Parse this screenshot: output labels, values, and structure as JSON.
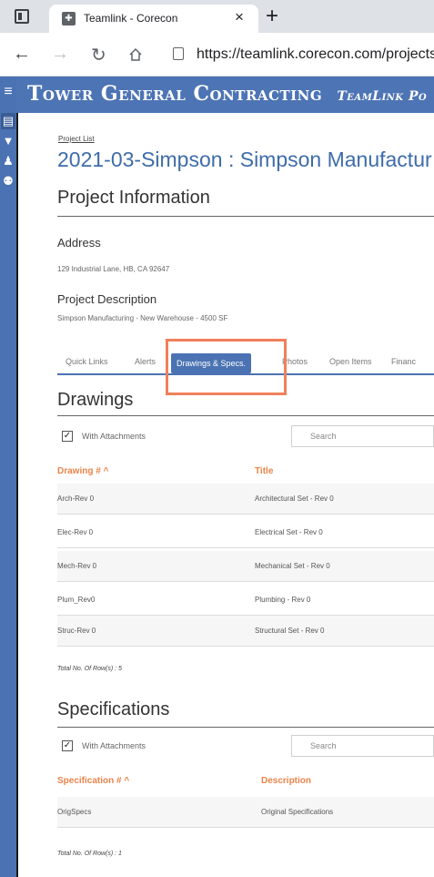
{
  "browser": {
    "tab_title": "Teamlink - Corecon",
    "tab_close": "×",
    "new_tab": "+",
    "url": "https://teamlink.corecon.com/projects/"
  },
  "header": {
    "brand": "Tower General Contracting",
    "sub": "TeamLink Po"
  },
  "breadcrumb": "Project List",
  "project_title": "2021-03-Simpson : Simpson Manufactur",
  "project_info": {
    "heading": "Project Information",
    "address_label": "Address",
    "address_value": "129 Industrial Lane, HB, CA 92647",
    "description_label": "Project Description",
    "description_value": "Simpson Manufacturing - New Warehouse - 4500 SF"
  },
  "tabs": [
    "Quick Links",
    "Alerts",
    "Drawings & Specs.",
    "Photos",
    "Open Items",
    "Financ"
  ],
  "drawings": {
    "heading": "Drawings",
    "checkbox_label": "With Attachments",
    "search_placeholder": "Search",
    "col1": "Drawing #",
    "col2": "Title",
    "rows": [
      {
        "num": "Arch-Rev 0",
        "title": "Architectural Set - Rev 0"
      },
      {
        "num": "Elec-Rev 0",
        "title": "Electrical Set - Rev 0"
      },
      {
        "num": "Mech-Rev 0",
        "title": "Mechanical Set - Rev 0"
      },
      {
        "num": "Plum_Rev0",
        "title": "Plumbing - Rev 0"
      },
      {
        "num": "Struc-Rev 0",
        "title": "Structural Set - Rev 0"
      }
    ],
    "total": "Total No. Of Row(s) : 5"
  },
  "specifications": {
    "heading": "Specifications",
    "checkbox_label": "With Attachments",
    "search_placeholder": "Search",
    "col1": "Specification #",
    "col2": "Description",
    "rows": [
      {
        "num": "OrigSpecs",
        "title": "Original Specifications"
      }
    ],
    "total": "Total No. Of Row(s) : 1"
  },
  "colors": {
    "brand_blue": "#4d74b4",
    "title_blue": "#3e6caa",
    "header_orange": "#e8844a",
    "highlight": "#f0805a"
  },
  "icons": {
    "sort": "chevron-up-icon",
    "check": "check-icon"
  }
}
